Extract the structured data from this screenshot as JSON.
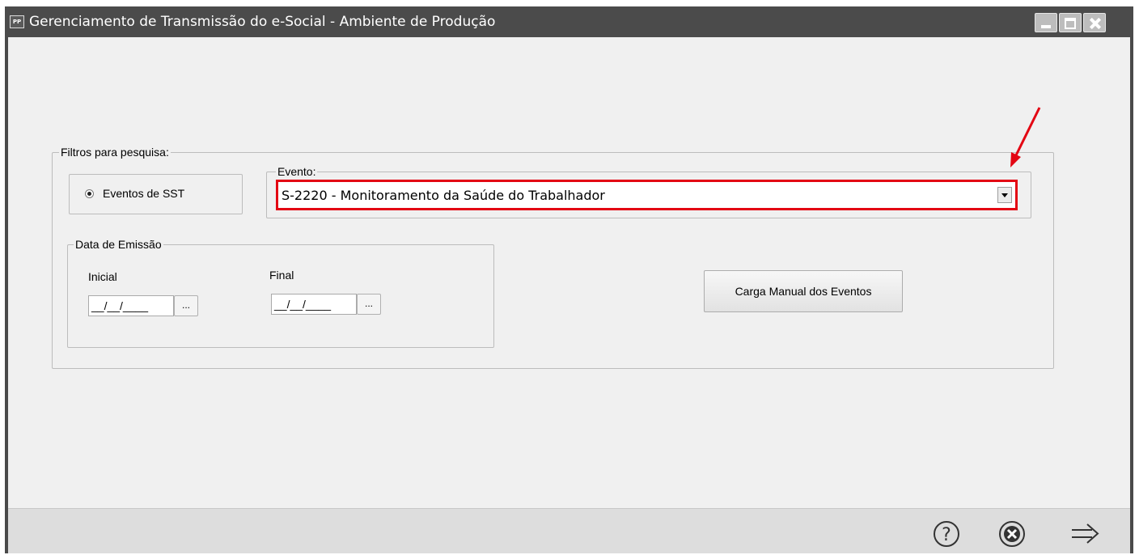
{
  "window": {
    "app_icon_text": "PP",
    "title": "Gerenciamento de Transmissão do e-Social - Ambiente de Produção"
  },
  "filtros": {
    "legend": "Filtros para pesquisa:",
    "radio_label": "Eventos de SST",
    "evento_legend": "Evento:",
    "evento_value": "S-2220 - Monitoramento da Saúde do Trabalhador"
  },
  "data_emissao": {
    "legend": "Data de Emissão",
    "inicial_label": "Inicial",
    "final_label": "Final",
    "inicial_value": "__/__/____",
    "final_value": "__/__/____",
    "picker_label": "..."
  },
  "carga_button": "Carga Manual dos Eventos",
  "colors": {
    "highlight": "#e30613",
    "titlebar": "#4b4b4b",
    "client": "#f0f0f0"
  },
  "footer_icons": [
    "help-icon",
    "cancel-icon",
    "next-arrow-icon"
  ]
}
